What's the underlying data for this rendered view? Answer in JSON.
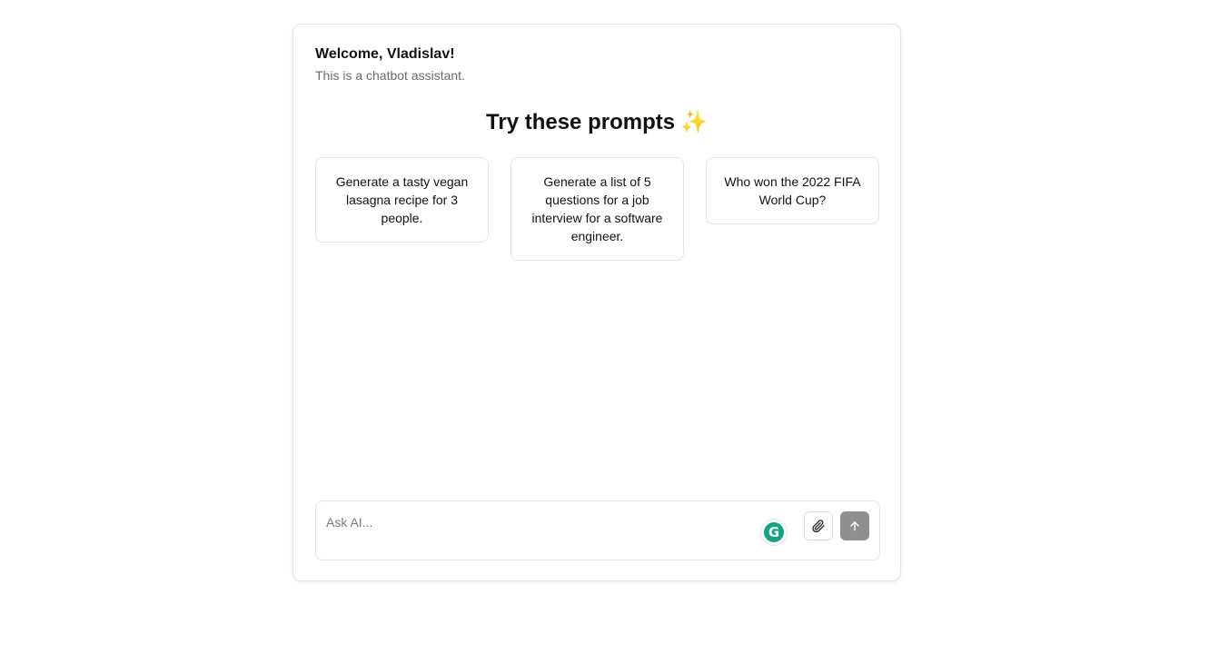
{
  "header": {
    "welcome": "Welcome, Vladislav!",
    "subtitle": "This is a chatbot assistant."
  },
  "prompts": {
    "heading": "Try these prompts",
    "heading_emoji": "✨",
    "items": [
      {
        "label": "Generate a tasty vegan lasagna recipe for 3 people."
      },
      {
        "label": "Generate a list of 5 questions for a job interview for a software engineer."
      },
      {
        "label": "Who won the 2022 FIFA World Cup?"
      }
    ]
  },
  "composer": {
    "placeholder": "Ask AI...",
    "value": "",
    "icons": {
      "grammarly": "grammarly-icon",
      "attach": "paperclip-icon",
      "send": "arrow-up-icon"
    }
  },
  "colors": {
    "send_button": "#8f8f8f",
    "grammarly": "#15a37f",
    "sparkle": "#f0a830",
    "border": "#e3e3e3"
  }
}
